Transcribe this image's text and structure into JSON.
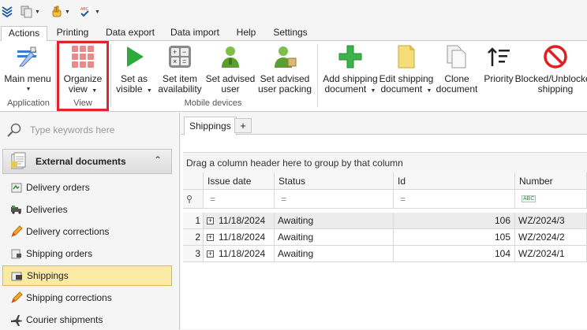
{
  "tabs": [
    "Actions",
    "Printing",
    "Data export",
    "Data import",
    "Help",
    "Settings"
  ],
  "ribbon": {
    "application_group": {
      "caption": "Application",
      "main_menu": "Main menu"
    },
    "view_group": {
      "caption": "View",
      "organize_line1": "Organize",
      "organize_line2": "view"
    },
    "mobile_group": {
      "caption": "Mobile devices",
      "set_visible_1": "Set as",
      "set_visible_2": "visible",
      "set_avail_1": "Set item",
      "set_avail_2": "availability",
      "set_user_1": "Set advised",
      "set_user_2": "user",
      "set_packing_1": "Set advised",
      "set_packing_2": "user packing"
    },
    "doc_group": {
      "add_1": "Add shipping",
      "add_2": "document",
      "edit_1": "Edit shipping",
      "edit_2": "document",
      "clone_1": "Clone",
      "clone_2": "document",
      "priority": "Priority",
      "block_1": "Blocked/Unblocked",
      "block_2": "shipping"
    }
  },
  "sidebar": {
    "search_placeholder": "Type keywords here",
    "group_title": "External documents",
    "items": [
      "Delivery orders",
      "Deliveries",
      "Delivery corrections",
      "Shipping orders",
      "Shippings",
      "Shipping corrections",
      "Courier shipments"
    ]
  },
  "main": {
    "tab_label": "Shippings",
    "add_tab": "+",
    "drag_hint": "Drag a column header here to group by that column",
    "columns": [
      "Issue date",
      "Status",
      "Id",
      "Number"
    ],
    "filter_eq": "=",
    "filter_abc": "ABC",
    "rows": [
      {
        "rn": "1",
        "date": "11/18/2024",
        "status": "Awaiting",
        "id": "106",
        "number": "WZ/2024/3"
      },
      {
        "rn": "2",
        "date": "11/18/2024",
        "status": "Awaiting",
        "id": "105",
        "number": "WZ/2024/2"
      },
      {
        "rn": "3",
        "date": "11/18/2024",
        "status": "Awaiting",
        "id": "104",
        "number": "WZ/2024/1"
      }
    ]
  },
  "colors": {
    "highlight": "#e0242a",
    "selection": "#fbe9a6",
    "play": "#2daa3c",
    "plus": "#3cb44a",
    "block": "#e02020"
  }
}
